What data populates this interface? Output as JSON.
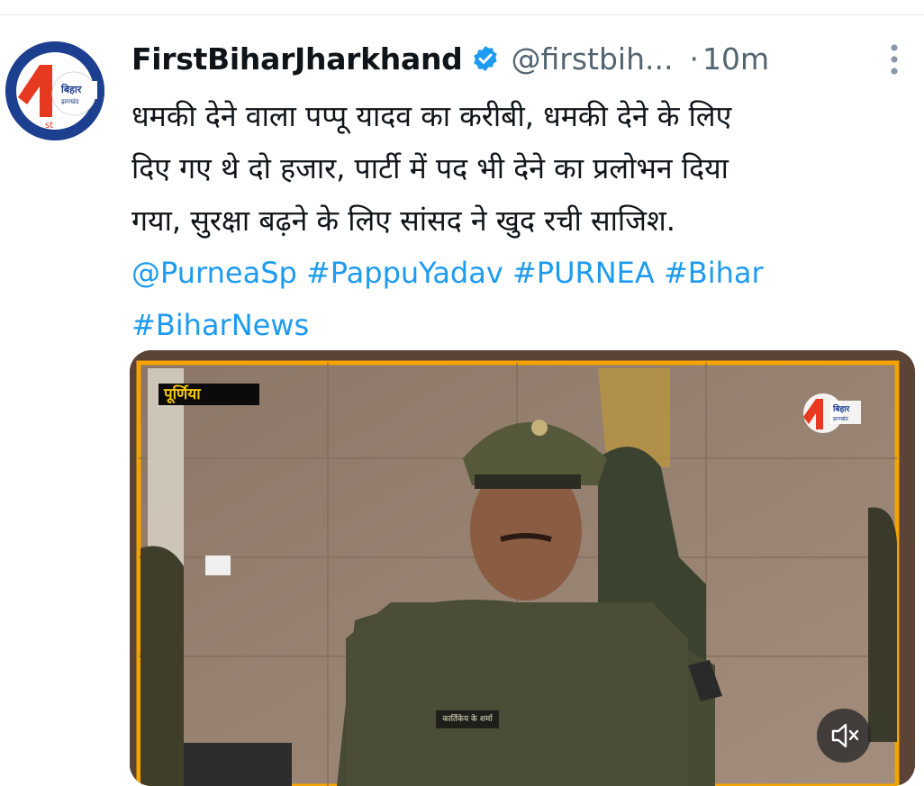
{
  "colors": {
    "text": "#0f1419",
    "muted": "#536471",
    "link": "#1d9bf0",
    "verified": "#1d9bf0",
    "frame": "#f4a300"
  },
  "tweet": {
    "avatar_icon": "firstbihar-logo",
    "avatar_text": "बिहार",
    "avatar_subtext": "झारखंड",
    "display_name": "FirstBiharJharkhand",
    "verified_icon": "verified-badge-icon",
    "handle": "@firstbih...",
    "separator": "·",
    "time": "10m",
    "more_icon": "more-vertical-icon",
    "text_lines": [
      "धमकी देने वाला पप्पू यादव का करीबी, धमकी देने के लिए",
      "दिए गए थे दो हजार, पार्टी में पद भी देने का प्रलोभन दिया",
      "गया, सुरक्षा बढ़ने के लिए सांसद ने खुद रची साजिश."
    ],
    "mentions": {
      "mention": "@PurneaSp",
      "tag1": "#PappuYadav",
      "tag2": "#PURNEA",
      "tag3": "#Bihar",
      "tag4": "#BiharNews"
    }
  },
  "media": {
    "location_label": "पूर्णिया",
    "channel_logo": "firstbihar-logo",
    "channel_logo_text": "बिहार",
    "channel_logo_subtext": "झारखंड",
    "nameplate": "कार्तिकेय के शर्मा",
    "mute_icon": "volume-muted-icon"
  }
}
